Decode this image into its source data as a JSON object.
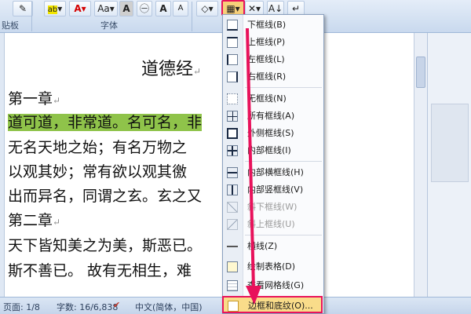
{
  "ribbon": {
    "clipboard_label": "贴板",
    "font_label": "字体",
    "font_size_label": "Aa",
    "grow": "A",
    "shrink": "A",
    "char_border": "A",
    "phonetic": "㊀",
    "sort": "↓",
    "show_marks": "↵"
  },
  "document": {
    "title": "道德经",
    "lines": [
      "第一章",
      "道可道，非常道。名可名，",
      "无名天地之始；有名万物之",
      "以观其妙；常有欲以观其徼",
      "出而异名，同谓之玄。玄之又",
      "第二章",
      "天下皆知美之为美，斯恶已。",
      "斯不善已。  故有无相生，难"
    ],
    "highlight_tail": "非",
    "para_mark": "↵"
  },
  "menu": {
    "items": [
      {
        "label": "下框线(B)",
        "disabled": false
      },
      {
        "label": "上框线(P)",
        "disabled": false
      },
      {
        "label": "左框线(L)",
        "disabled": false
      },
      {
        "label": "右框线(R)",
        "disabled": false
      },
      {
        "label": "无框线(N)",
        "disabled": false
      },
      {
        "label": "所有框线(A)",
        "disabled": false
      },
      {
        "label": "外侧框线(S)",
        "disabled": false
      },
      {
        "label": "内部框线(I)",
        "disabled": false
      },
      {
        "label": "内部横框线(H)",
        "disabled": false
      },
      {
        "label": "内部竖框线(V)",
        "disabled": false
      },
      {
        "label": "斜下框线(W)",
        "disabled": true
      },
      {
        "label": "斜上框线(U)",
        "disabled": true
      },
      {
        "label": "横线(Z)",
        "disabled": false
      },
      {
        "label": "绘制表格(D)",
        "disabled": false
      },
      {
        "label": "查看网格线(G)",
        "disabled": false
      },
      {
        "label": "边框和底纹(O)...",
        "disabled": false
      }
    ]
  },
  "status": {
    "page": "1/8",
    "words": "字数: 16/6,838",
    "language": "中文(简体，中国)"
  },
  "colors": {
    "highlight": "#8fc34a",
    "annotation": "#e8125b",
    "font_red": "#d40000"
  }
}
